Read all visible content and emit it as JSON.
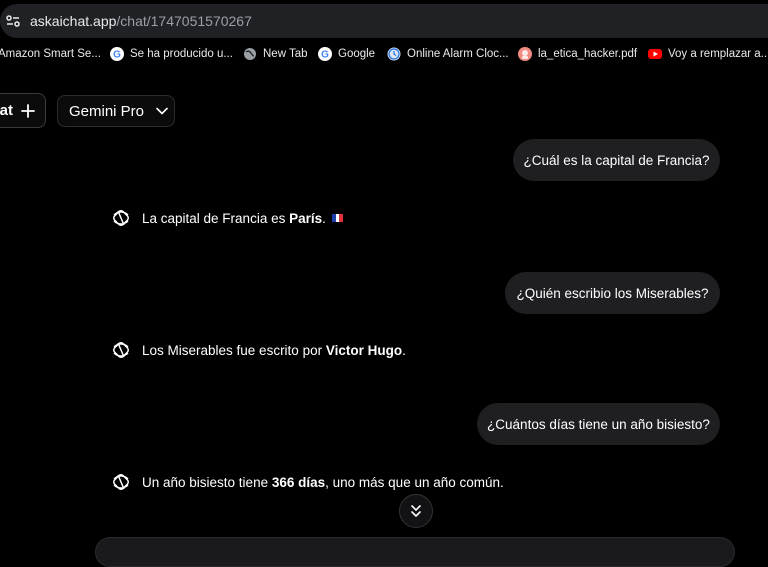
{
  "browser": {
    "url_host": "askaichat.app",
    "url_path": "/chat/1747051570267"
  },
  "bookmarks": [
    {
      "label": "Amazon Smart Se...",
      "icon": "none"
    },
    {
      "label": "Se ha producido u...",
      "icon": "google-icon"
    },
    {
      "label": "New Tab",
      "icon": "globe-icon"
    },
    {
      "label": "Google",
      "icon": "google-icon"
    },
    {
      "label": "Online Alarm Cloc...",
      "icon": "clock-icon"
    },
    {
      "label": "la_etica_hacker.pdf",
      "icon": "pdf-icon"
    },
    {
      "label": "Voy a remplazar a...",
      "icon": "youtube-icon"
    }
  ],
  "toolbar": {
    "new_chat_label": "at",
    "model_label": "Gemini Pro"
  },
  "conversation": [
    {
      "role": "user",
      "text": "¿Cuál es la capital de Francia?"
    },
    {
      "role": "ai",
      "pre": "La capital de Francia es ",
      "bold": "París",
      "post": ".",
      "flag": "france-flag"
    },
    {
      "role": "user",
      "text": "¿Quién escribio los Miserables?"
    },
    {
      "role": "ai",
      "pre": "Los Miserables fue escrito por ",
      "bold": "Victor Hugo",
      "post": "."
    },
    {
      "role": "user",
      "text": "¿Cuántos días tiene un año bisiesto?"
    },
    {
      "role": "ai",
      "pre": "Un año bisiesto tiene ",
      "bold": "366 días",
      "post": ", uno más que un año común."
    }
  ],
  "colors": {
    "background": "#000000",
    "user_bubble": "#1f1f22",
    "address_bar": "#202124"
  }
}
